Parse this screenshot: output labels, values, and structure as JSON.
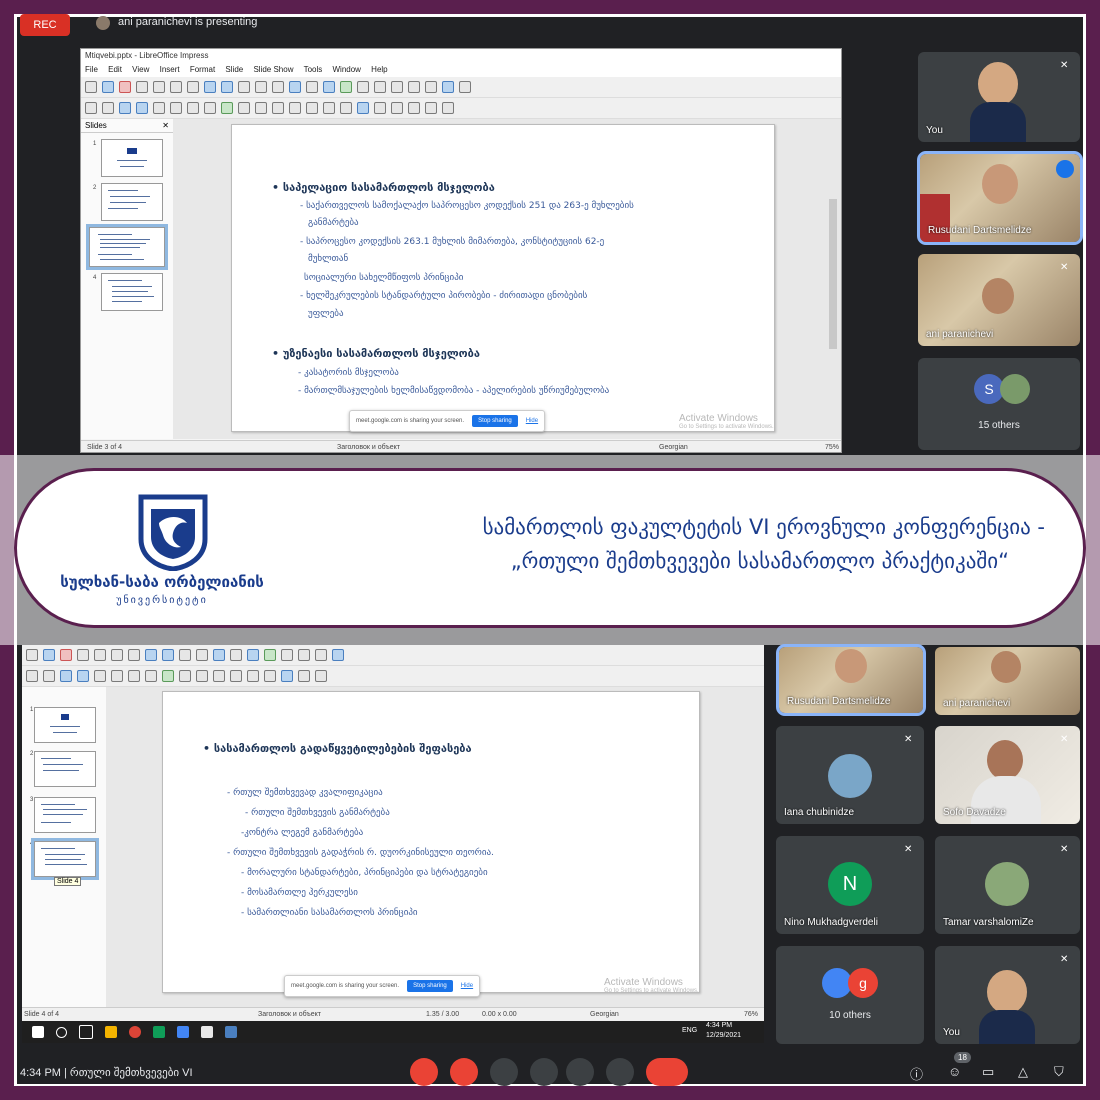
{
  "meet": {
    "rec_label": "REC",
    "presenting_text": "ani paranichevi is presenting",
    "time_meeting": "4:34 PM  |  რთული შემთხვევები VI",
    "participant_count": "18",
    "participants_top": [
      {
        "name": "You"
      },
      {
        "name": "Rusudani Dartsmelidze"
      },
      {
        "name": "ani paranichevi"
      },
      {
        "name": "15 others",
        "initial": "S"
      }
    ],
    "participants_bottom": [
      {
        "name": "Rusudani Dartsmelidze"
      },
      {
        "name": "ani paranichevi"
      },
      {
        "name": "Iana chubinidze"
      },
      {
        "name": "Sofo Davadze"
      },
      {
        "name": "Nino Mukhadgverdeli",
        "initial": "N"
      },
      {
        "name": "Tamar varshalomiZe"
      },
      {
        "name": "10 others",
        "initial": "g"
      },
      {
        "name": "You"
      }
    ]
  },
  "impress_top": {
    "title": "Mtiqvebi.pptx - LibreOffice Impress",
    "menu": [
      "File",
      "Edit",
      "View",
      "Insert",
      "Format",
      "Slide",
      "Slide Show",
      "Tools",
      "Window",
      "Help"
    ],
    "panel_title": "Slides",
    "slide": {
      "heading1": "• საპელაციო სასამართლოს მსჯელობა",
      "lines1": [
        "- საქართველოს სამოქალაქო საპროცესო კოდექსის 251 და 263-ე მუხლების",
        "განმარტება",
        "- საპროცესო კოდექსის 263.1 მუხლის მიმართება, კონსტიტუციის 62-ე",
        "მუხლთან",
        "სოციალური სახელმწიფოს პრინციპი",
        "- ხელშეკრულების სტანდარტული პირობები - ძირითადი ცნობების",
        "უფლება"
      ],
      "heading2": "• უზენაესი სასამართლოს მსჯელობა",
      "lines2": [
        "- კასატორის მსჯელობა",
        "- მართლმსაჯულების ხელმისაწვდომობა - აპელირების უწრიუმებულობა"
      ]
    },
    "status_left": "Slide 3 of 4",
    "status_mid": "Заголовок и объект",
    "status_lang": "Georgian",
    "status_zoom": "75%",
    "share_text": "meet.google.com is sharing your screen.",
    "share_stop": "Stop sharing",
    "share_hide": "Hide",
    "activate_title": "Activate Windows",
    "activate_sub": "Go to Settings to activate Windows."
  },
  "banner": {
    "logo_line1": "სულხან-საბა ორბელიანის",
    "logo_line2": "უნივერსიტეტი",
    "title_line1": "სამართლის ფაკულტეტის VI ეროვნული კონფერენცია -",
    "title_line2": "„რთული შემთხვევები სასამართლო პრაქტიკაში“"
  },
  "impress_bottom": {
    "slide": {
      "heading": "• სასამართლოს გადაწყვეტილებების შეფასება",
      "lines": [
        "- რთულ შემთხვევად კვალიფიკაცია",
        "- რთული შემთხვევის განმარტება",
        "-კონტრა ლეგემ განმარტება",
        "- რთული შემთხვევის გადაჭრის რ. დუორკინისეული თეორია.",
        "- მორალური სტანდარტები, პრინციპები და სტრატეგიები",
        "- მოსამართლე ჰერკულესი",
        "- სამართლიანი სასამართლოს პრინციპი"
      ]
    },
    "thumb_tooltip": "Slide 4",
    "status_left": "Slide 4 of 4",
    "status_mid": "Заголовок и объект",
    "status_coords": "1.35 / 3.00",
    "status_size": "0.00 x 0.00",
    "status_lang": "Georgian",
    "status_zoom": "76%",
    "share_text": "meet.google.com is sharing your screen.",
    "share_stop": "Stop sharing",
    "share_hide": "Hide",
    "activate_title": "Activate Windows",
    "activate_sub": "Go to Settings to activate Windows.",
    "tray_lang": "ENG",
    "tray_time": "4:34 PM",
    "tray_date": "12/29/2021"
  }
}
